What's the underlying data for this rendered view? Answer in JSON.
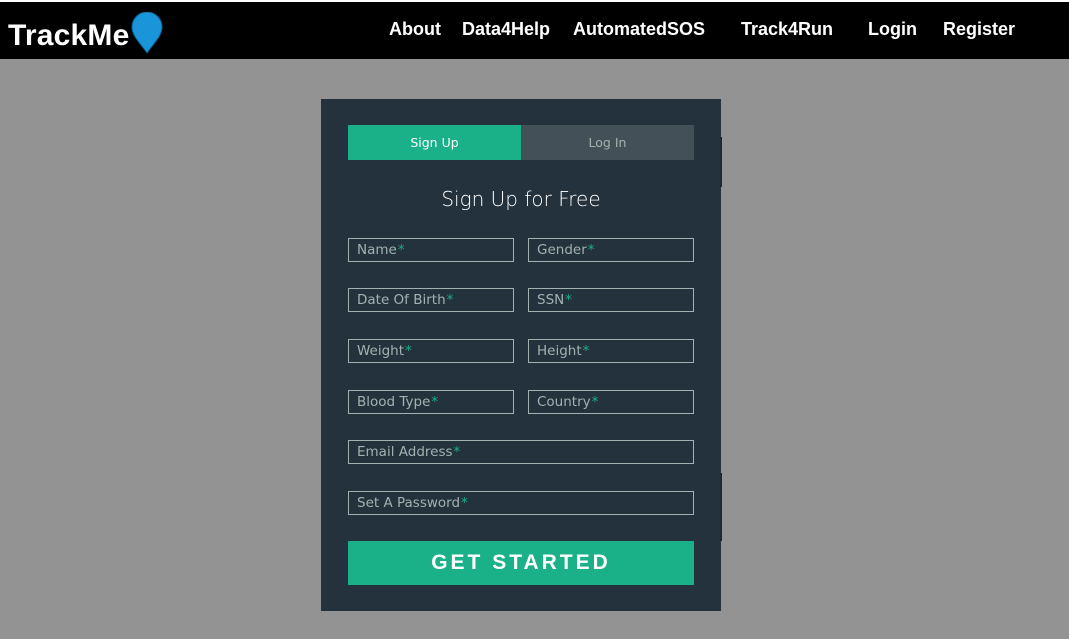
{
  "header": {
    "logo_text": "TrackMe",
    "logo_icon": "map-pin-icon",
    "nav": [
      {
        "label": "About"
      },
      {
        "label": "Data4Help"
      },
      {
        "label": "AutomatedSOS"
      },
      {
        "label": "Track4Run"
      },
      {
        "label": "Login"
      },
      {
        "label": "Register"
      }
    ]
  },
  "form": {
    "tabs": [
      {
        "label": "Sign Up",
        "active": true
      },
      {
        "label": "Log In",
        "active": false
      }
    ],
    "title": "Sign Up for Free",
    "required_marker": "*",
    "fields": {
      "name": "Name",
      "gender": "Gender",
      "dob": "Date Of Birth",
      "ssn": "SSN",
      "weight": "Weight",
      "height": "Height",
      "blood_type": "Blood Type",
      "country": "Country",
      "email": "Email Address",
      "password": "Set A Password"
    },
    "submit_label": "GET STARTED"
  },
  "colors": {
    "accent": "#1ab188",
    "card_bg": "#24323d",
    "page_bg": "#939393",
    "header_bg": "#000000",
    "pin": "#1a95d9"
  }
}
